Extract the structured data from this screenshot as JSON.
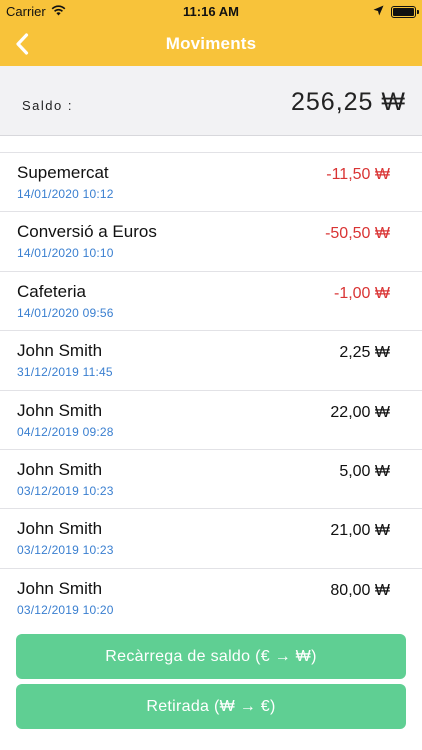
{
  "status_bar": {
    "carrier": "Carrier",
    "time": "11:16 AM"
  },
  "nav": {
    "title": "Moviments",
    "back_icon": "chevron-left-icon"
  },
  "balance": {
    "label": "Saldo :",
    "value": "256,25 ₩"
  },
  "transactions": [
    {
      "name": "Supemercat",
      "date": "14/01/2020 10:12",
      "amount": "-11,50 ₩",
      "negative": true
    },
    {
      "name": "Conversió a Euros",
      "date": "14/01/2020 10:10",
      "amount": "-50,50 ₩",
      "negative": true
    },
    {
      "name": "Cafeteria",
      "date": "14/01/2020 09:56",
      "amount": "-1,00 ₩",
      "negative": true
    },
    {
      "name": "John Smith",
      "date": "31/12/2019 11:45",
      "amount": "2,25 ₩",
      "negative": false
    },
    {
      "name": "John Smith",
      "date": "04/12/2019 09:28",
      "amount": "22,00 ₩",
      "negative": false
    },
    {
      "name": "John Smith",
      "date": "03/12/2019 10:23",
      "amount": "5,00 ₩",
      "negative": false
    },
    {
      "name": "John Smith",
      "date": "03/12/2019 10:23",
      "amount": "21,00 ₩",
      "negative": false
    },
    {
      "name": "John Smith",
      "date": "03/12/2019 10:20",
      "amount": "80,00 ₩",
      "negative": false
    }
  ],
  "buttons": {
    "recharge": "Recàrrega de saldo (€ → ₩)",
    "withdraw": "Retirada (₩ → €)"
  },
  "colors": {
    "header": "#f8c33a",
    "negative": "#d93434",
    "date": "#3a7fd0",
    "button": "#5fcf93"
  }
}
